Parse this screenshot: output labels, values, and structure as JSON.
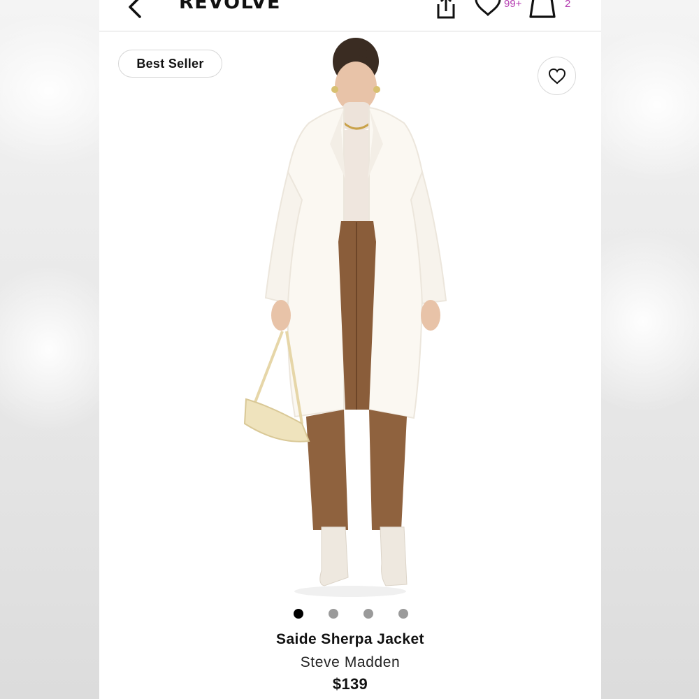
{
  "header": {
    "logo": "REVOLVE",
    "wishlist_count": "99+",
    "bag_count": "2",
    "accent_color": "#b43bb0"
  },
  "icons": {
    "back": "chevron-left-icon",
    "share": "share-icon",
    "wishlist": "heart-icon",
    "bag": "shopping-bag-icon",
    "favorite": "heart-icon"
  },
  "product": {
    "badge": "Best Seller",
    "image_description_icon": "product-photo",
    "title": "Saide Sherpa Jacket",
    "brand": "Steve Madden",
    "price": "$139"
  },
  "carousel": {
    "total": 4,
    "active_index": 0
  }
}
